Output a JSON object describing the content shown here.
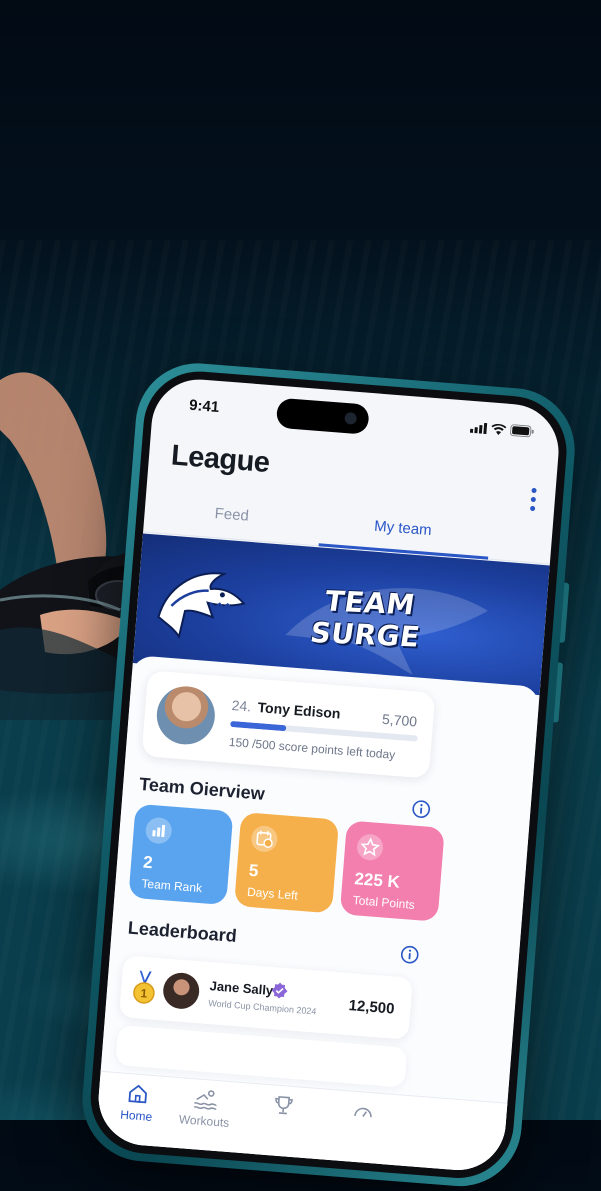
{
  "status_bar": {
    "time": "9:41"
  },
  "header": {
    "title": "League"
  },
  "tabs": [
    {
      "label": "Feed",
      "active": false
    },
    {
      "label": "My team",
      "active": true
    }
  ],
  "banner": {
    "team_line1": "TEAM",
    "team_line2": "SURGE"
  },
  "profile": {
    "rank": "24.",
    "name": "Tony Edison",
    "score": "5,700",
    "progress_fraction": 0.3,
    "progress_text": "150 /500 score points left today"
  },
  "team_overview": {
    "title": "Team Oierview",
    "stats": [
      {
        "value": "2",
        "label": "Team Rank",
        "icon": "bar-chart-icon",
        "color": "#5aa4ef"
      },
      {
        "value": "5",
        "label": "Days Left",
        "icon": "calendar-clock-icon",
        "color": "#f5b04c"
      },
      {
        "value": "225 K",
        "label": "Total Points",
        "icon": "star-icon",
        "color": "#f27fae"
      }
    ]
  },
  "leaderboard": {
    "title": "Leaderboard",
    "entries": [
      {
        "position": "1",
        "name": "Jane Sally",
        "subtitle": "World Cup Champion 2024",
        "score": "12,500"
      }
    ]
  },
  "bottom_nav": [
    {
      "label": "Home",
      "icon": "home-icon",
      "active": true
    },
    {
      "label": "Workouts",
      "icon": "swim-icon",
      "active": false
    },
    {
      "label": "",
      "icon": "trophy-icon",
      "active": false
    },
    {
      "label": "",
      "icon": "gauge-icon",
      "active": false
    }
  ],
  "colors": {
    "accent": "#2a56c6",
    "banner": "#1c3f9e",
    "phone_frame": "#0f5a66"
  }
}
